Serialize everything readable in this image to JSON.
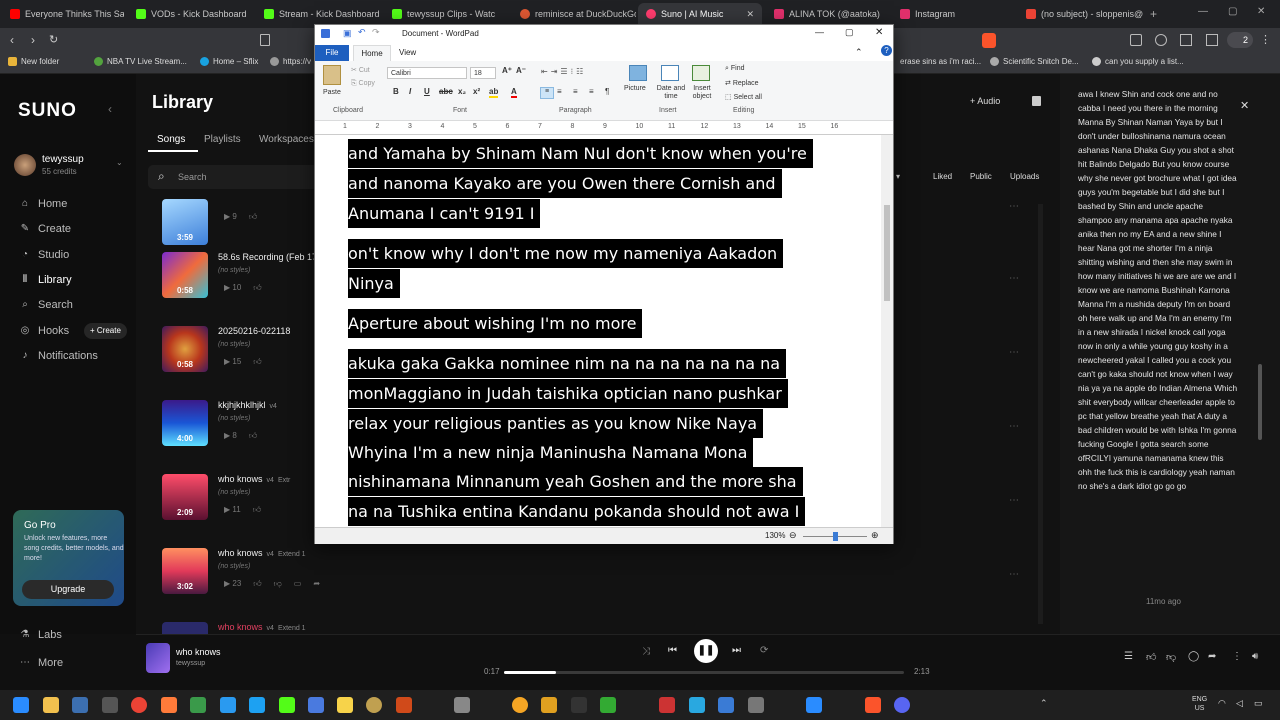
{
  "browser": {
    "tabs": [
      {
        "label": "Everyone Thinks This Sau",
        "color": "#ff0000"
      },
      {
        "label": "VODs - Kick Dashboard",
        "color": "#53fc18"
      },
      {
        "label": "Stream - Kick Dashboard",
        "color": "#53fc18"
      },
      {
        "label": "tewyssup Clips - Watc",
        "color": "#53fc18"
      },
      {
        "label": "reminisce at DuckDuckGo",
        "color": "#de5833"
      },
      {
        "label": "Suno | AI Music",
        "color": "#ff3c6e"
      },
      {
        "label": "ALINA TOK (@aatoka)",
        "color": "#e1306c"
      },
      {
        "label": "Instagram",
        "color": "#e1306c"
      },
      {
        "label": "(no subject) - sloppenis@",
        "color": "#ea4335"
      }
    ],
    "bookmarks": [
      "New folder",
      "NBA TV Live Stream...",
      "Home – Sflix",
      "https://v",
      "erase sins as i'm raci...",
      "Scientific Snitch De...",
      "can you supply a list..."
    ],
    "profile_count": "2"
  },
  "suno": {
    "logo": "SUNO",
    "user": {
      "name": "tewyssup",
      "credits": "55 credits"
    },
    "nav": [
      "Home",
      "Create",
      "Studio",
      "Library",
      "Search",
      "Hooks",
      "Notifications"
    ],
    "hooks_create": "+ Create",
    "gopro": {
      "title": "Go Pro",
      "text": "Unlock new features, more song credits, better models, and more!",
      "button": "Upgrade"
    },
    "bottom_nav": [
      "Labs",
      "More"
    ],
    "library": {
      "title": "Library",
      "tabs": [
        "Songs",
        "Playlists",
        "Workspaces"
      ],
      "search_placeholder": "Search",
      "filters": [
        "Liked",
        "Public",
        "Uploads"
      ],
      "add_audio": "+ Audio"
    },
    "songs": [
      {
        "title": "",
        "duration": "3:59",
        "style": "",
        "plays": "9",
        "version": ""
      },
      {
        "title": "58.6s Recording (Feb 17",
        "duration": "0:58",
        "style": "(no styles)",
        "plays": "10",
        "version": ""
      },
      {
        "title": "20250216-022118",
        "duration": "0:58",
        "style": "(no styles)",
        "plays": "15",
        "version": ""
      },
      {
        "title": "kkjhjkhklhjkl",
        "duration": "4:00",
        "style": "(no styles)",
        "plays": "8",
        "version": "v4"
      },
      {
        "title": "who knows",
        "duration": "2:09",
        "style": "(no styles)",
        "plays": "11",
        "version": "v4",
        "extra": "Extr"
      },
      {
        "title": "who knows",
        "duration": "3:02",
        "style": "(no styles)",
        "plays": "23",
        "version": "v4",
        "extra": "Extend 1"
      },
      {
        "title": "who knows",
        "duration": "",
        "style": "",
        "plays": "",
        "version": "v4",
        "extra": "Extend 1"
      }
    ],
    "lyrics": "awa I knew Shin and cock one and no cabba I need you there in the morning Manna By Shinan Naman Yaya by but I don't under bulloshinama namura ocean ashanas Nana Dhaka Guy you shot a shot hit Balindo Delgado But you know course why she never got brochure what I got idea guys you'm begetable but I did she but I bashed by Shin and uncle apache shampoo any manama apa apache nyaka anika then no my EA and a new shine I hear Nana got me shorter I'm a ninja shitting wishing and then she may swim in how many initiatives hi we are are we and I know we are namoma Bushinah Karnona Manna I'm a nushida deputy I'm on board oh here walk up and Ma I'm an enemy I'm in a new shirada I nickel knock call yoga now in only a while young guy koshy in a newcheered yakal I called you a cock you can't go kaka should not know when I way nia ya ya na apple do Indian Almena Which shit everybody willcar cheerleader apple to pc that yellow breathe yeah that A duty a bad children would be with Ishka I'm gonna fucking Google I gotta search some ofRCILYI yamuna namanama knew this ohh the fuck this is cardiology yeah naman no she's a dark idiot go go go",
    "lyrics_time": "11mo ago",
    "player": {
      "title": "who knows",
      "artist": "tewyssup",
      "elapsed": "0:17",
      "total": "2:13",
      "progress": 0.13
    }
  },
  "wordpad": {
    "title": "Document - WordPad",
    "menu": [
      "File",
      "Home",
      "View"
    ],
    "font": "Calibri",
    "size": "18",
    "groups": [
      "Clipboard",
      "Font",
      "Paragraph",
      "Insert",
      "Editing"
    ],
    "clipboard": {
      "paste": "Paste",
      "cut": "Cut",
      "copy": "Copy"
    },
    "insert": [
      "Picture",
      "Date and time",
      "Insert object"
    ],
    "editing": [
      "Find",
      "Replace",
      "Select all"
    ],
    "ruler": [
      "1",
      "2",
      "3",
      "4",
      "5",
      "6",
      "7",
      "8",
      "9",
      "10",
      "11",
      "12",
      "13",
      "14",
      "15",
      "16"
    ],
    "lines": [
      " and Yamaha by Shinam Nam NuI don't know when you're",
      "and nanoma Kayako are you Owen  there Cornish and",
      "Anumana  I can't 9191 I",
      "on't know why I don't me now my nameniya Aakadon",
      "Ninya",
      "Aperture about wishing I'm no more",
      "akuka gaka Gakka nominee nim na na na na na na na",
      "monMaggiano in Judah taishika  optician nano pushkar",
      "relax your religious panties as you know Nike Naya",
      "Whyina I'm a new ninja Maninusha Namana Mona",
      "nishinamana Minnanum  yeah Goshen and the more sha",
      "na na Tushika entina Kandanu pokanda should not awa I"
    ],
    "zoom": "130%"
  },
  "taskbar": {
    "lang": "ENG",
    "region": "US"
  }
}
